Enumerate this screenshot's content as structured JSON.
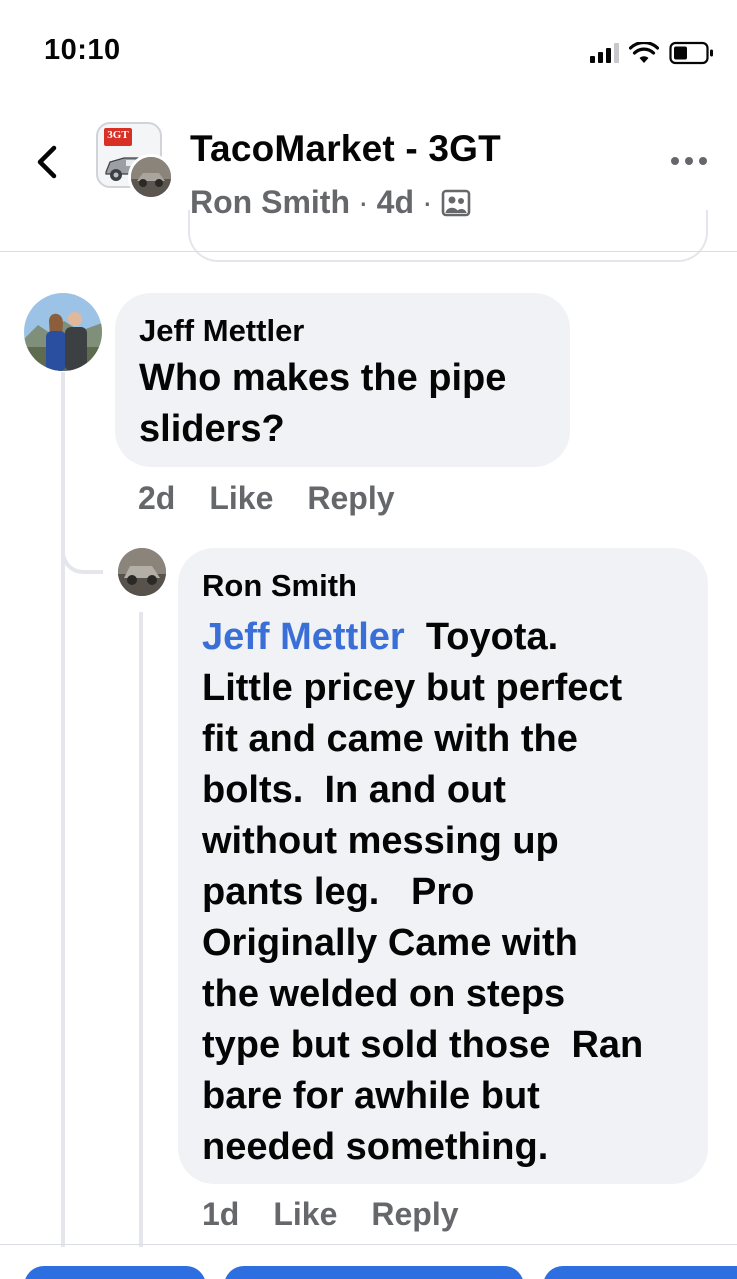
{
  "status_bar": {
    "time": "10:10",
    "icons": [
      "signal-icon",
      "wifi-icon",
      "battery-icon"
    ]
  },
  "header": {
    "back_icon": "chevron-left-icon",
    "group_name": "TacoMarket - 3GT",
    "group_logo_text": "3GT",
    "poster_name": "Ron Smith",
    "post_age": "4d",
    "separator": "·",
    "audience_icon": "group-audience-icon",
    "more_icon": "more-horizontal-icon"
  },
  "comments": [
    {
      "author": "Jeff Mettler",
      "lines": [
        "Who makes the pipe",
        "sliders?"
      ],
      "age": "2d",
      "like_label": "Like",
      "reply_label": "Reply"
    },
    {
      "author": "Ron Smith",
      "mention": "Jeff Mettler",
      "first_line_rest": "Toyota.",
      "lines": [
        "Little pricey but perfect",
        "fit and came with the",
        "bolts.  In and out",
        "without messing up",
        "pants leg.   Pro",
        "Originally Came with",
        "the welded on steps",
        "type but sold those  Ran",
        "bare for awhile but",
        "needed something."
      ],
      "age": "1d",
      "like_label": "Like",
      "reply_label": "Reply"
    }
  ],
  "colors": {
    "accent": "#2d6fe0",
    "mention": "#3b6fd8",
    "meta_gray": "#65676b",
    "bubble": "#f0f2f5"
  }
}
